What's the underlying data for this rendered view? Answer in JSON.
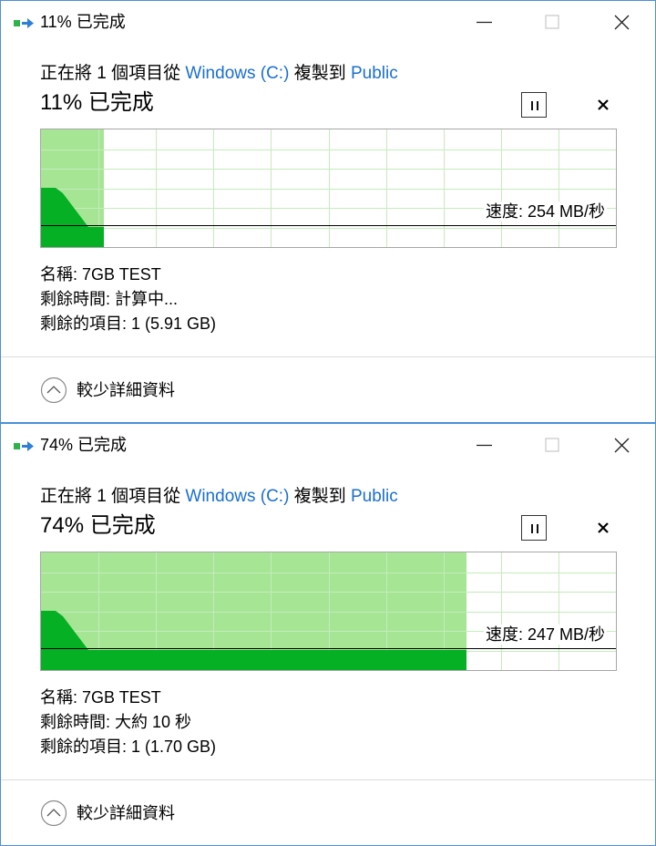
{
  "dialogs": [
    {
      "title": "11% 已完成",
      "desc": {
        "prefix": "正在將 1 個項目從 ",
        "source": "Windows (C:)",
        "middle": " 複製到 ",
        "dest": "Public"
      },
      "percent_label": "11% 已完成",
      "progress": 0.11,
      "speed": "速度: 254 MB/秒",
      "name": "名稱: 7GB TEST",
      "time_remaining": "剩餘時間: 計算中...",
      "items_remaining": "剩餘的項目: 1 (5.91 GB)",
      "less_details": "較少詳細資料"
    },
    {
      "title": "74% 已完成",
      "desc": {
        "prefix": "正在將 1 個項目從 ",
        "source": "Windows (C:)",
        "middle": " 複製到 ",
        "dest": "Public"
      },
      "percent_label": "74% 已完成",
      "progress": 0.74,
      "speed": "速度: 247 MB/秒",
      "name": "名稱: 7GB TEST",
      "time_remaining": "剩餘時間: 大約 10 秒",
      "items_remaining": "剩餘的項目: 1 (1.70 GB)",
      "less_details": "較少詳細資料"
    }
  ],
  "colors": {
    "fill_light": "#a6e594",
    "fill_dark": "#06b025",
    "grid": "#c4ecbb",
    "link": "#1a6fd0",
    "border": "#4a90d9"
  },
  "icons": [
    "copy-icon",
    "minimize-icon",
    "maximize-icon",
    "close-icon",
    "pause-icon",
    "cancel-icon",
    "chevron-up-icon"
  ]
}
